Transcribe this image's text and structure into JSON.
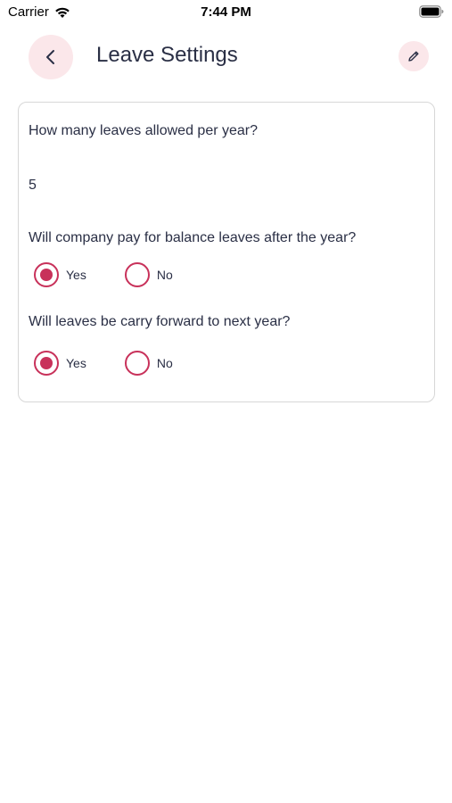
{
  "status_bar": {
    "carrier": "Carrier",
    "time": "7:44 PM",
    "wifi_icon": "wifi-icon",
    "battery_icon": "battery-icon"
  },
  "header": {
    "title": "Leave Settings",
    "back_icon": "chevron-left-icon",
    "edit_icon": "pencil-icon"
  },
  "form": {
    "q1": {
      "label": "How many leaves allowed per year?",
      "value": "5"
    },
    "q2": {
      "label": "Will company pay for balance leaves after the year?",
      "options": [
        "Yes",
        "No"
      ],
      "selected": "Yes"
    },
    "q3": {
      "label": "Will leaves be carry forward to next year?",
      "options": [
        "Yes",
        "No"
      ],
      "selected": "Yes"
    }
  },
  "colors": {
    "accent": "#c8315a",
    "accent_bg": "#fbe7ea",
    "text": "#2a2f45"
  }
}
